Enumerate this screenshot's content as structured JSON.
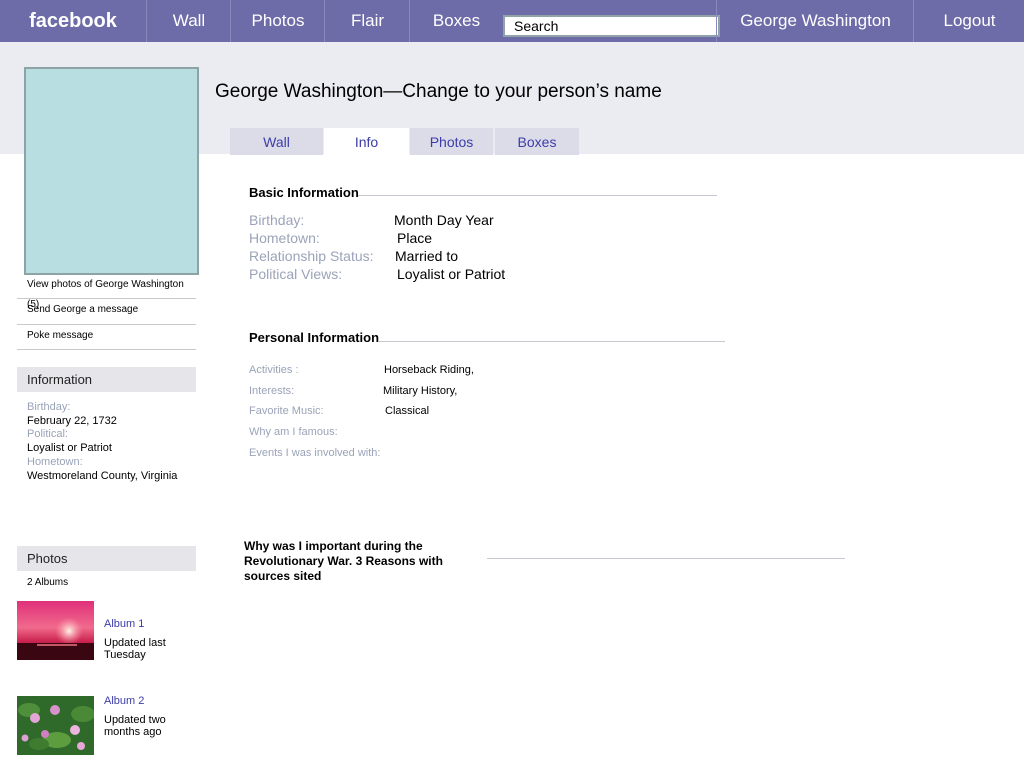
{
  "nav": {
    "logo": "facebook",
    "items": [
      "Wall",
      "Photos",
      "Flair",
      "Boxes"
    ],
    "search_placeholder": "Search",
    "user_name": "George Washington",
    "logout": "Logout"
  },
  "profile": {
    "title": "George Washington—Change to your person’s name",
    "tabs": [
      "Wall",
      "Info",
      "Photos",
      "Boxes"
    ],
    "active_tab": "Info"
  },
  "sidebar": {
    "links": [
      "View photos of George Washington (5)",
      "Send George a message",
      "Poke message"
    ],
    "info_header": "Information",
    "info": [
      {
        "label": "Birthday:",
        "value": "February 22, 1732"
      },
      {
        "label": "Political:",
        "value": "Loyalist or Patriot"
      },
      {
        "label": "Hometown:",
        "value": "Westmoreland County, Virginia"
      }
    ],
    "photos_header": "Photos",
    "albums_count": "2 Albums",
    "albums": [
      {
        "name": "Album 1",
        "updated": "Updated last Tuesday"
      },
      {
        "name": "Album 2",
        "updated": "Updated two months ago"
      }
    ]
  },
  "basic": {
    "title": "Basic Information",
    "rows": [
      {
        "label": "Birthday:",
        "value": "Month Day Year"
      },
      {
        "label": "Hometown:",
        "value": "Place"
      },
      {
        "label": "Relationship Status:",
        "value": "Married to"
      },
      {
        "label": "Political Views:",
        "value": "Loyalist or Patriot"
      }
    ]
  },
  "personal": {
    "title": "Personal Information",
    "rows": [
      {
        "label": "Activities :",
        "value": "Horseback Riding,"
      },
      {
        "label": "Interests:",
        "value": "Military History,"
      },
      {
        "label": "Favorite Music:",
        "value": "Classical"
      },
      {
        "label": "Why am I famous:",
        "value": ""
      },
      {
        "label": "Events I was involved with:",
        "value": ""
      }
    ]
  },
  "importance": {
    "title": "Why was I important during the Revolutionary War.  3 Reasons with sources sited"
  },
  "colors": {
    "nav_bg": "#6d6ba8",
    "band_bg": "#ebebf2",
    "profile_pic": "#b9dee1",
    "link": "#3c3ca8",
    "label": "#9aa3b8"
  }
}
